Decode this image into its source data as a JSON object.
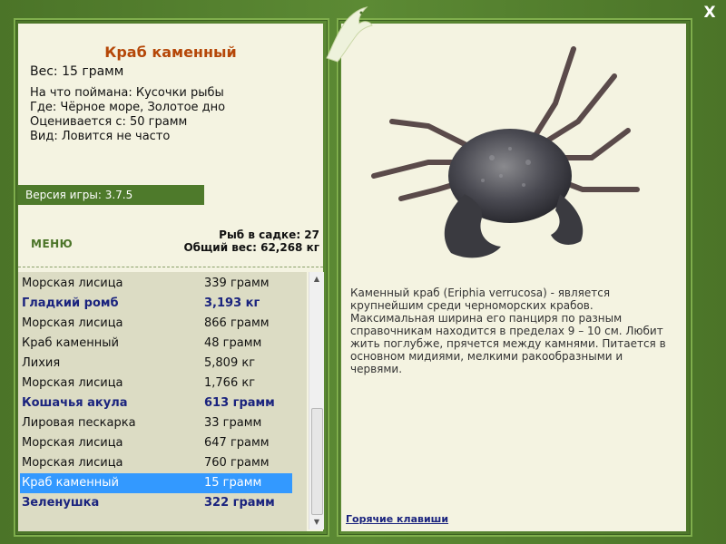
{
  "fish": {
    "title": "Краб каменный",
    "weight": "Вес: 15 грамм",
    "caught_with": "На что поймана: Кусочки рыбы",
    "where": "Где: Чёрное море, Золотое дно",
    "valued_from": "Оценивается с: 50 грамм",
    "rarity": "Вид: Ловится не часто"
  },
  "version": "Версия игры: 3.7.5",
  "menu_label": "МЕНЮ",
  "stats": {
    "catch_count": "Рыб в садке: 27",
    "total_weight": "Общий вес: 62,268 кг"
  },
  "catch_list": [
    {
      "name": "Морская лисица",
      "weight": "339 грамм",
      "bold": false
    },
    {
      "name": "Гладкий ромб",
      "weight": "3,193 кг",
      "bold": true
    },
    {
      "name": "Морская лисица",
      "weight": "866 грамм",
      "bold": false
    },
    {
      "name": "Краб каменный",
      "weight": "48 грамм",
      "bold": false
    },
    {
      "name": "Лихия",
      "weight": "5,809 кг",
      "bold": false
    },
    {
      "name": "Морская лисица",
      "weight": "1,766 кг",
      "bold": false
    },
    {
      "name": "Кошачья акула",
      "weight": "613 грамм",
      "bold": true
    },
    {
      "name": "Лировая пескарка",
      "weight": "33 грамм",
      "bold": false
    },
    {
      "name": "Морская лисица",
      "weight": "647 грамм",
      "bold": false
    },
    {
      "name": "Морская лисица",
      "weight": "760 грамм",
      "bold": false
    },
    {
      "name": "Краб каменный",
      "weight": "15 грамм",
      "bold": false,
      "selected": true
    },
    {
      "name": "Зеленушка",
      "weight": "322 грамм",
      "bold": true
    }
  ],
  "description": "Каменный краб (Eriphia verrucosa) - является крупнейшим среди черноморских крабов. Максимальная ширина его панциря по разным справочникам находится в пределах 9 – 10 см. Любит жить поглубже, прячется между камнями. Питается в основном мидиями, мелкими ракообразными и червями.",
  "hotkeys_label": "Горячие клавиши",
  "close_label": "X",
  "icons": {
    "close": "close-icon",
    "logo": "dolphin-logo-icon",
    "scroll_up": "arrow-up-icon",
    "scroll_down": "arrow-down-icon"
  },
  "colors": {
    "frame": "#4f7a2c",
    "panel_bg": "#f4f3e1",
    "title": "#b54708",
    "bold_row": "#1a237e",
    "selected_row": "#3399ff"
  }
}
